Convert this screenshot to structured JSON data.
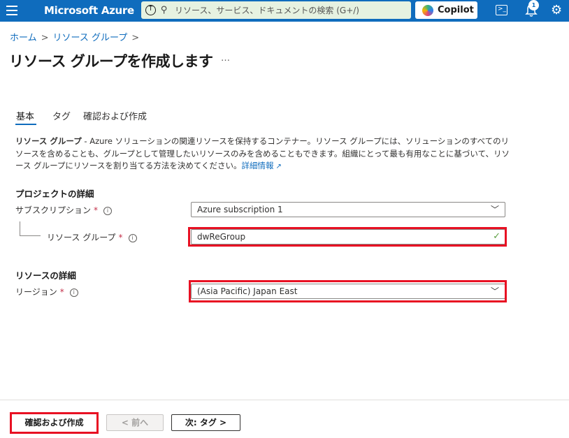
{
  "topbar": {
    "brand": "Microsoft Azure",
    "search_placeholder": "リソース、サービス、ドキュメントの検索 (G+/)",
    "copilot_label": "Copilot",
    "notification_count": "1",
    "accent": "#0f6cbd"
  },
  "breadcrumb": {
    "home": "ホーム",
    "resource_groups": "リソース グループ",
    "sep": ">"
  },
  "page": {
    "title": "リソース グループを作成します",
    "more": "…"
  },
  "tabs": [
    {
      "label": "基本",
      "active": true
    },
    {
      "label": "タグ",
      "active": false
    },
    {
      "label": "確認および作成",
      "active": false
    }
  ],
  "description": {
    "term": "リソース グループ",
    "text": " - Azure ソリューションの関連リソースを保持するコンテナー。リソース グループには、ソリューションのすべてのリソースを含めることも、グループとして管理したいリソースのみを含めることもできます。組織にとって最も有用なことに基づいて、リソース グループにリソースを割り当てる方法を決めてください。",
    "link": "詳細情報"
  },
  "project": {
    "heading": "プロジェクトの詳細",
    "subscription_label": "サブスクリプション",
    "subscription_value": "Azure subscription 1",
    "rg_label": "リソース グループ",
    "rg_value": "dwReGroup"
  },
  "resource": {
    "heading": "リソースの詳細",
    "region_label": "リージョン",
    "region_value": "(Asia Pacific) Japan East"
  },
  "required_mark": "*",
  "info_mark": "i",
  "footer": {
    "review_create": "確認および作成",
    "prev": "< 前へ",
    "next": "次: タグ >"
  },
  "highlight_color": "#e81123"
}
